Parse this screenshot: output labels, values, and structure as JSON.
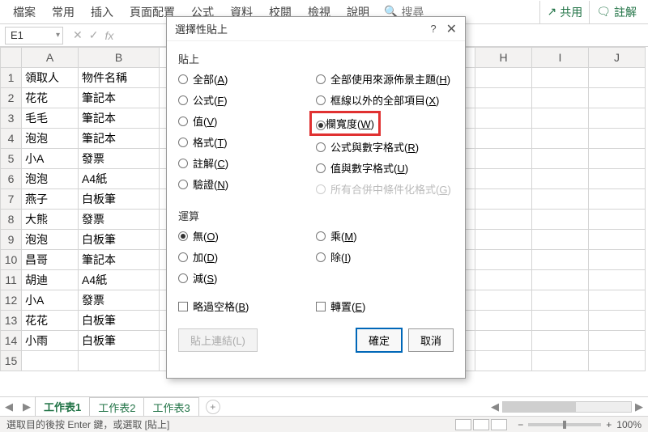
{
  "ribbon": {
    "tabs": [
      "檔案",
      "常用",
      "插入",
      "頁面配置",
      "公式",
      "資料",
      "校閱",
      "檢視",
      "說明"
    ],
    "search": "搜尋",
    "share": "共用",
    "comment": "註解"
  },
  "namebox": {
    "ref": "E1"
  },
  "columns": [
    "A",
    "B",
    "H",
    "I",
    "J"
  ],
  "rows": [
    {
      "n": "1",
      "a": "領取人",
      "b": "物件名稱"
    },
    {
      "n": "2",
      "a": "花花",
      "b": "筆記本"
    },
    {
      "n": "3",
      "a": "毛毛",
      "b": "筆記本"
    },
    {
      "n": "4",
      "a": "泡泡",
      "b": "筆記本"
    },
    {
      "n": "5",
      "a": "小A",
      "b": "發票"
    },
    {
      "n": "6",
      "a": "泡泡",
      "b": "A4紙"
    },
    {
      "n": "7",
      "a": "燕子",
      "b": "白板筆"
    },
    {
      "n": "8",
      "a": "大熊",
      "b": "發票"
    },
    {
      "n": "9",
      "a": "泡泡",
      "b": "白板筆"
    },
    {
      "n": "10",
      "a": "昌哥",
      "b": "筆記本"
    },
    {
      "n": "11",
      "a": "胡迪",
      "b": "A4紙"
    },
    {
      "n": "12",
      "a": "小A",
      "b": "發票"
    },
    {
      "n": "13",
      "a": "花花",
      "b": "白板筆"
    },
    {
      "n": "14",
      "a": "小雨",
      "b": "白板筆"
    },
    {
      "n": "15",
      "a": "",
      "b": ""
    }
  ],
  "sheets": {
    "tabs": [
      "工作表1",
      "工作表2",
      "工作表3"
    ],
    "active": 0
  },
  "status": {
    "text": "選取目的後按 Enter 鍵，或選取 [貼上]",
    "zoom": "100%"
  },
  "dialog": {
    "title": "選擇性貼上",
    "section_paste": "貼上",
    "paste_left": [
      {
        "t": "全部",
        "k": "A",
        "sel": false
      },
      {
        "t": "公式",
        "k": "F",
        "sel": false
      },
      {
        "t": "值",
        "k": "V",
        "sel": false
      },
      {
        "t": "格式",
        "k": "T",
        "sel": false
      },
      {
        "t": "註解",
        "k": "C",
        "sel": false
      },
      {
        "t": "驗證",
        "k": "N",
        "sel": false
      }
    ],
    "paste_right": [
      {
        "t": "全部使用來源佈景主題",
        "k": "H",
        "sel": false
      },
      {
        "t": "框線以外的全部項目",
        "k": "X",
        "sel": false
      },
      {
        "t": "欄寬度",
        "k": "W",
        "sel": true,
        "hl": true
      },
      {
        "t": "公式與數字格式",
        "k": "R",
        "sel": false
      },
      {
        "t": "值與數字格式",
        "k": "U",
        "sel": false
      },
      {
        "t": "所有合併中條件化格式",
        "k": "G",
        "sel": false,
        "disabled": true
      }
    ],
    "section_op": "運算",
    "op_left": [
      {
        "t": "無",
        "k": "O",
        "sel": true
      },
      {
        "t": "加",
        "k": "D",
        "sel": false
      },
      {
        "t": "減",
        "k": "S",
        "sel": false
      }
    ],
    "op_right": [
      {
        "t": "乘",
        "k": "M",
        "sel": false
      },
      {
        "t": "除",
        "k": "I",
        "sel": false
      }
    ],
    "chk_skip": {
      "t": "略過空格",
      "k": "B"
    },
    "chk_transpose": {
      "t": "轉置",
      "k": "E"
    },
    "btn_link": "貼上連結(L)",
    "btn_ok": "確定",
    "btn_cancel": "取消"
  }
}
